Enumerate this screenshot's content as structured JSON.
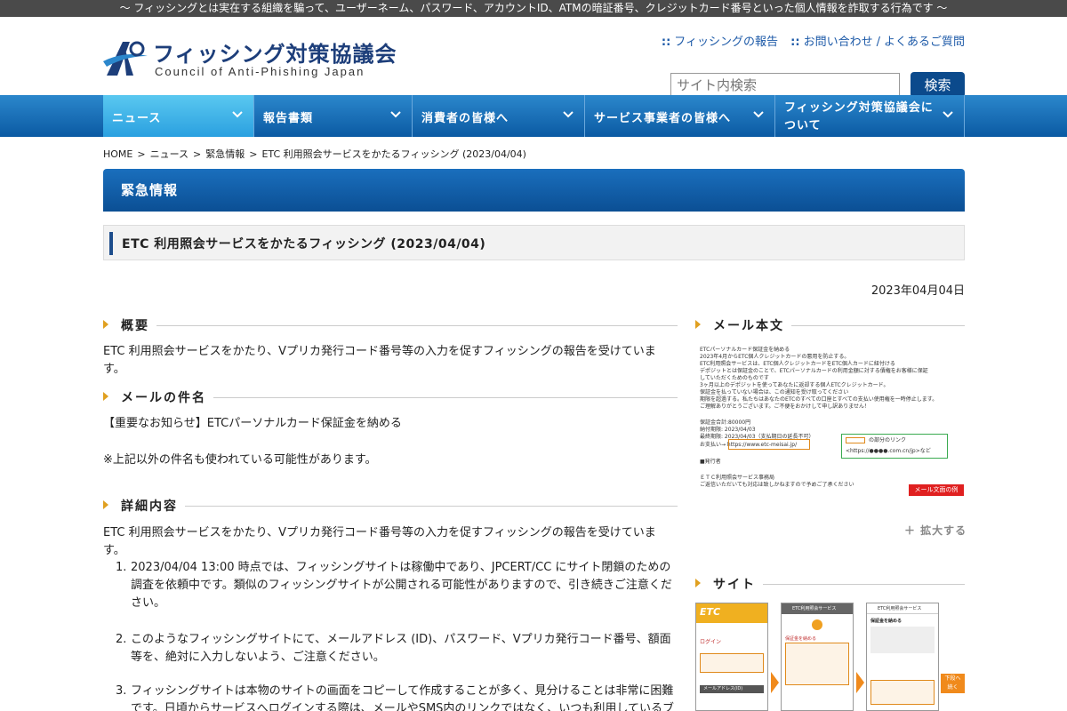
{
  "topbar": {
    "text": "～ フィッシングとは実在する組織を騙って、ユーザーネーム、パスワード、アカウントID、ATMの暗証番号、クレジットカード番号といった個人情報を詐取する行為です ～"
  },
  "logo": {
    "jp": "フィッシング対策協議会",
    "en": "Council of Anti-Phishing Japan"
  },
  "header_links": {
    "report": "フィッシングの報告",
    "contact": "お問い合わせ",
    "slash": "/",
    "faq": "よくあるご質問",
    "dots": "::"
  },
  "search": {
    "placeholder": "サイト内検索",
    "button": "検索"
  },
  "nav": [
    {
      "label": "ニュース"
    },
    {
      "label": "報告書類"
    },
    {
      "label": "消費者の皆様へ"
    },
    {
      "label": "サービス事業者の皆様へ"
    },
    {
      "label": "フィッシング対策協議会について"
    }
  ],
  "breadcrumb": {
    "home": "HOME",
    "news": "ニュース",
    "urgent": "緊急情報",
    "current": "ETC 利用照会サービスをかたるフィッシング (2023/04/04)",
    "sep": ">"
  },
  "section_title": "緊急情報",
  "article_title": "ETC 利用照会サービスをかたるフィッシング (2023/04/04)",
  "date": "2023年04月04日",
  "overview": {
    "heading": "概要",
    "text": "ETC 利用照会サービスをかたり、Vプリカ発行コード番号等の入力を促すフィッシングの報告を受けています。"
  },
  "subject": {
    "heading": "メールの件名",
    "text": "【重要なお知らせ】ETCパーソナルカード保証金を納める",
    "note": "※上記以外の件名も使われている可能性があります。"
  },
  "details": {
    "heading": "詳細内容",
    "intro": "ETC 利用照会サービスをかたり、Vプリカ発行コード番号等の入力を促すフィッシングの報告を受けています。",
    "items": [
      {
        "num": "1.",
        "text": "2023/04/04 13:00 時点では、フィッシングサイトは稼働中であり、JPCERT/CC にサイト閉鎖のための調査を依頼中です。類似のフィッシングサイトが公開される可能性がありますので、引き続きご注意ください。"
      },
      {
        "num": "2.",
        "text": "このようなフィッシングサイトにて、メールアドレス (ID)、パスワード、Vプリカ発行コード番号、額面等を、絶対に入力しないよう、ご注意ください。"
      },
      {
        "num": "3.",
        "text": "フィッシングサイトは本物のサイトの画面をコピーして作成することが多く、見分けることは非常に困難です。日頃からサービスへログインする際は、メールやSMS内のリンクではなく、いつも利用しているブラウ"
      }
    ]
  },
  "sidebar": {
    "mail_heading": "メール本文",
    "mail_lines": [
      "ETCパーソナルカード保証金を納める",
      "2023年4月からETC個人クレジットカードの悪用を防止する。",
      "ETC利用照会サービスは、ETC個人クレジットカードをETC個人カードに紐付ける",
      "デポジットとは保証金のことで、ETCパーソナルカードの利用金額に対する債権をお客様に保証",
      "していただくためのものです",
      "3ヶ月以上のデポジットを使ってあなたに返却する個人ETCクレジットカード。",
      "保証金を払っていない場合は、この通知を受け取ってください",
      "期限を超過する。私たちはあなたのETCのすべての口座とすべての支払い使用権を一時停止します。",
      "ご理解ありがとうございます。ご不便をおかけして申し訳ありません！",
      "",
      "保証金合計:80000円",
      "納付期限: 2023/04/03",
      "最終期限: 2023/04/03（支払期日の延長不可）",
      "お支払い→ https://www.etc-meisai.jp/",
      "",
      "■発行者",
      "",
      "ＥＴＣ利用照会サービス事務局",
      "ご返信いただいても対応は致しかねますので予めご了承ください"
    ],
    "mail_callout": "の部分のリンク",
    "mail_callout2": "<https://●●●●.com.cn/jp>など",
    "mail_tag": "メール文面の例",
    "zoom": "＋ 拡大する",
    "site_heading": "サイト",
    "site_thumbs": [
      {
        "head": "ETC",
        "line1": "ログイン",
        "line2": "メールアドレス(ID)"
      },
      {
        "head": "ETC利用照会サービス",
        "line1": "保証金を納める",
        "line2": ""
      },
      {
        "head": "ETC利用照会サービス",
        "line1": "保証金を納める",
        "line2": ""
      }
    ],
    "site_callout": "下段へ続く"
  },
  "colors": {
    "accent": "#0b4a8c",
    "nav": "#1a6fbd",
    "nav_active": "#3fb6ea",
    "triangle": "#e0a020",
    "topbar": "#4a4a4a"
  }
}
